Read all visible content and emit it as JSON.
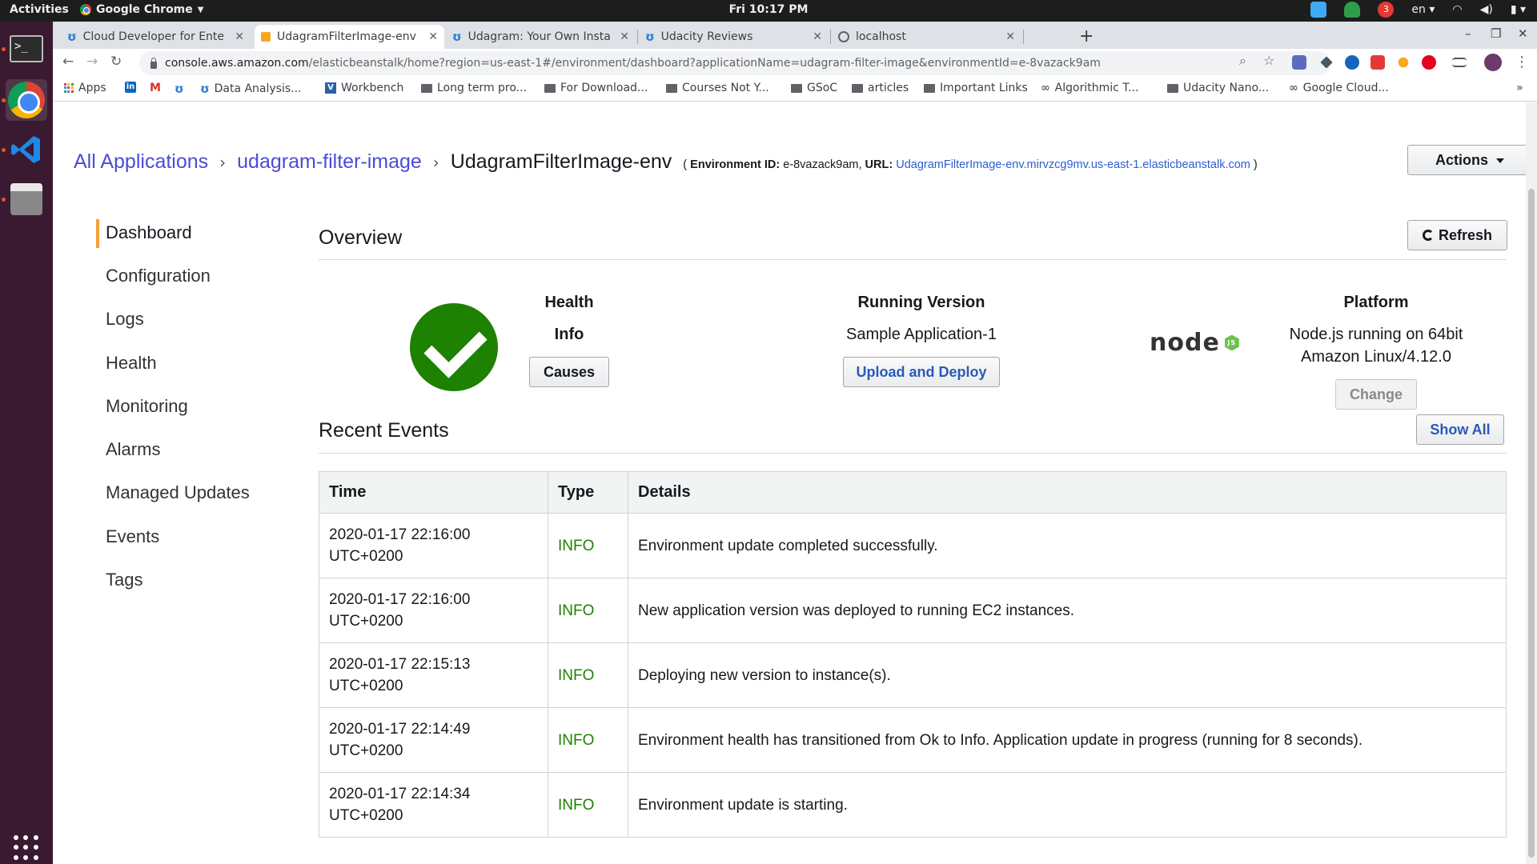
{
  "os": {
    "activities": "Activities",
    "app_name": "Google Chrome",
    "clock": "Fri 10:17 PM",
    "lang": "en",
    "notif_count": "3"
  },
  "browser": {
    "tabs": [
      {
        "title": "Cloud Developer for Ente",
        "icon": "udacity-icon",
        "active": false
      },
      {
        "title": "UdagramFilterImage-env",
        "icon": "aws-cube-icon",
        "active": true
      },
      {
        "title": "Udagram: Your Own Insta",
        "icon": "udacity-icon",
        "active": false
      },
      {
        "title": "Udacity Reviews",
        "icon": "udacity-icon",
        "active": false
      },
      {
        "title": "localhost",
        "icon": "globe-icon",
        "active": false
      }
    ],
    "url_host": "console.aws.amazon.com",
    "url_rest": "/elasticbeanstalk/home?region=us-east-1#/environment/dashboard?applicationName=udagram-filter-image&environmentId=e-8vazack9am",
    "bookmarks": [
      {
        "label": "Apps",
        "icon": "apps-grid-icon"
      },
      {
        "label": "",
        "icon": "linkedin-icon"
      },
      {
        "label": "",
        "icon": "gmail-icon"
      },
      {
        "label": "",
        "icon": "udacity-icon"
      },
      {
        "label": "Data Analysis...",
        "icon": "udacity-icon"
      },
      {
        "label": "Workbench",
        "icon": "workbench-icon"
      },
      {
        "label": "Long term pro...",
        "icon": "folder-icon"
      },
      {
        "label": "For Download...",
        "icon": "folder-icon"
      },
      {
        "label": "Courses Not Y...",
        "icon": "folder-icon"
      },
      {
        "label": "GSoC",
        "icon": "folder-icon"
      },
      {
        "label": "articles",
        "icon": "folder-icon"
      },
      {
        "label": "Important Links",
        "icon": "folder-icon"
      },
      {
        "label": "Algorithmic T...",
        "icon": "link-icon"
      },
      {
        "label": "Udacity Nano...",
        "icon": "folder-icon"
      },
      {
        "label": "Google Cloud...",
        "icon": "link-icon"
      }
    ],
    "more_bookmarks": "»"
  },
  "page": {
    "breadcrumb": {
      "all_apps": "All Applications",
      "app": "udagram-filter-image",
      "env": "UdagramFilterImage-env",
      "open_paren": "(",
      "env_id_label": "Environment ID:",
      "env_id": "e-8vazack9am,",
      "url_label": "URL:",
      "url": "UdagramFilterImage-env.mirvzcg9mv.us-east-1.elasticbeanstalk.com",
      "close_paren": ")",
      "sep": "›"
    },
    "actions_label": "Actions",
    "nav": [
      {
        "label": "Dashboard",
        "active": true
      },
      {
        "label": "Configuration",
        "active": false
      },
      {
        "label": "Logs",
        "active": false
      },
      {
        "label": "Health",
        "active": false
      },
      {
        "label": "Monitoring",
        "active": false
      },
      {
        "label": "Alarms",
        "active": false
      },
      {
        "label": "Managed Updates",
        "active": false
      },
      {
        "label": "Events",
        "active": false
      },
      {
        "label": "Tags",
        "active": false
      }
    ],
    "overview": {
      "title": "Overview",
      "refresh_label": "Refresh",
      "health": {
        "heading": "Health",
        "status": "Info",
        "causes_label": "Causes",
        "status_color": "#1d8102"
      },
      "running_version": {
        "heading": "Running Version",
        "value": "Sample Application-1",
        "upload_label": "Upload and Deploy"
      },
      "platform": {
        "heading": "Platform",
        "line1": "Node.js running on 64bit",
        "line2": "Amazon Linux/4.12.0",
        "change_label": "Change",
        "logo_text": "node",
        "logo_badge": "JS"
      }
    },
    "events": {
      "title": "Recent Events",
      "show_all_label": "Show All",
      "columns": [
        "Time",
        "Type",
        "Details"
      ],
      "rows": [
        {
          "time1": "2020-01-17 22:16:00",
          "time2": "UTC+0200",
          "type": "INFO",
          "details": "Environment update completed successfully."
        },
        {
          "time1": "2020-01-17 22:16:00",
          "time2": "UTC+0200",
          "type": "INFO",
          "details": "New application version was deployed to running EC2 instances."
        },
        {
          "time1": "2020-01-17 22:15:13",
          "time2": "UTC+0200",
          "type": "INFO",
          "details": "Deploying new version to instance(s)."
        },
        {
          "time1": "2020-01-17 22:14:49",
          "time2": "UTC+0200",
          "type": "INFO",
          "details": "Environment health has transitioned from Ok to Info. Application update in progress (running for 8 seconds)."
        },
        {
          "time1": "2020-01-17 22:14:34",
          "time2": "UTC+0200",
          "type": "INFO",
          "details": "Environment update is starting."
        }
      ]
    }
  },
  "colors": {
    "accent_orange": "#f0a13a",
    "link_blue": "#4b4bd9",
    "info_green": "#1d8102"
  }
}
